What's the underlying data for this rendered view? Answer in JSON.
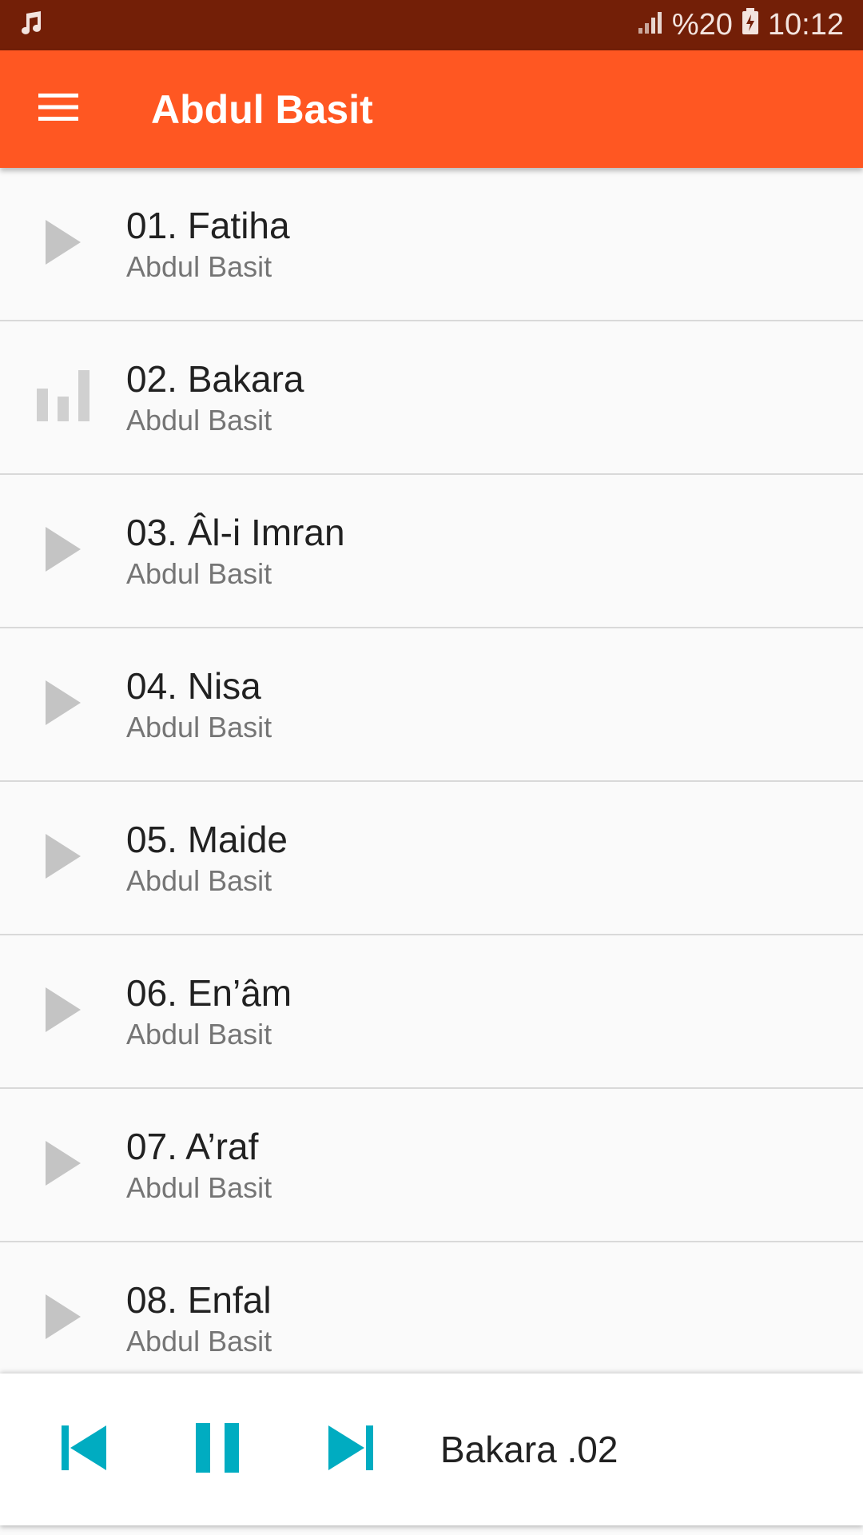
{
  "status_bar": {
    "notification_icon": "music-note-icon",
    "battery_text": "%20",
    "time": "10:12",
    "color": "#731f07"
  },
  "app_bar": {
    "title": "Abdul Basit",
    "menu_icon": "hamburger-menu-icon",
    "color": "#ff5722"
  },
  "tracks": [
    {
      "title": "01. Fatiha",
      "artist": "Abdul Basit",
      "icon": "play-icon"
    },
    {
      "title": "02. Bakara",
      "artist": "Abdul Basit",
      "icon": "now-playing-bars-icon"
    },
    {
      "title": "03. Âl-i Imran",
      "artist": "Abdul Basit",
      "icon": "play-icon"
    },
    {
      "title": "04. Nisa",
      "artist": "Abdul Basit",
      "icon": "play-icon"
    },
    {
      "title": "05. Maide",
      "artist": "Abdul Basit",
      "icon": "play-icon"
    },
    {
      "title": "06. En’âm",
      "artist": "Abdul Basit",
      "icon": "play-icon"
    },
    {
      "title": "07. A’raf",
      "artist": "Abdul Basit",
      "icon": "play-icon"
    },
    {
      "title": "08. Enfal",
      "artist": "Abdul Basit",
      "icon": "play-icon"
    }
  ],
  "player": {
    "now_playing": "Bakara .02",
    "controls": [
      "skip-previous-icon",
      "pause-icon",
      "skip-next-icon"
    ],
    "accent_color": "#00acc1"
  }
}
